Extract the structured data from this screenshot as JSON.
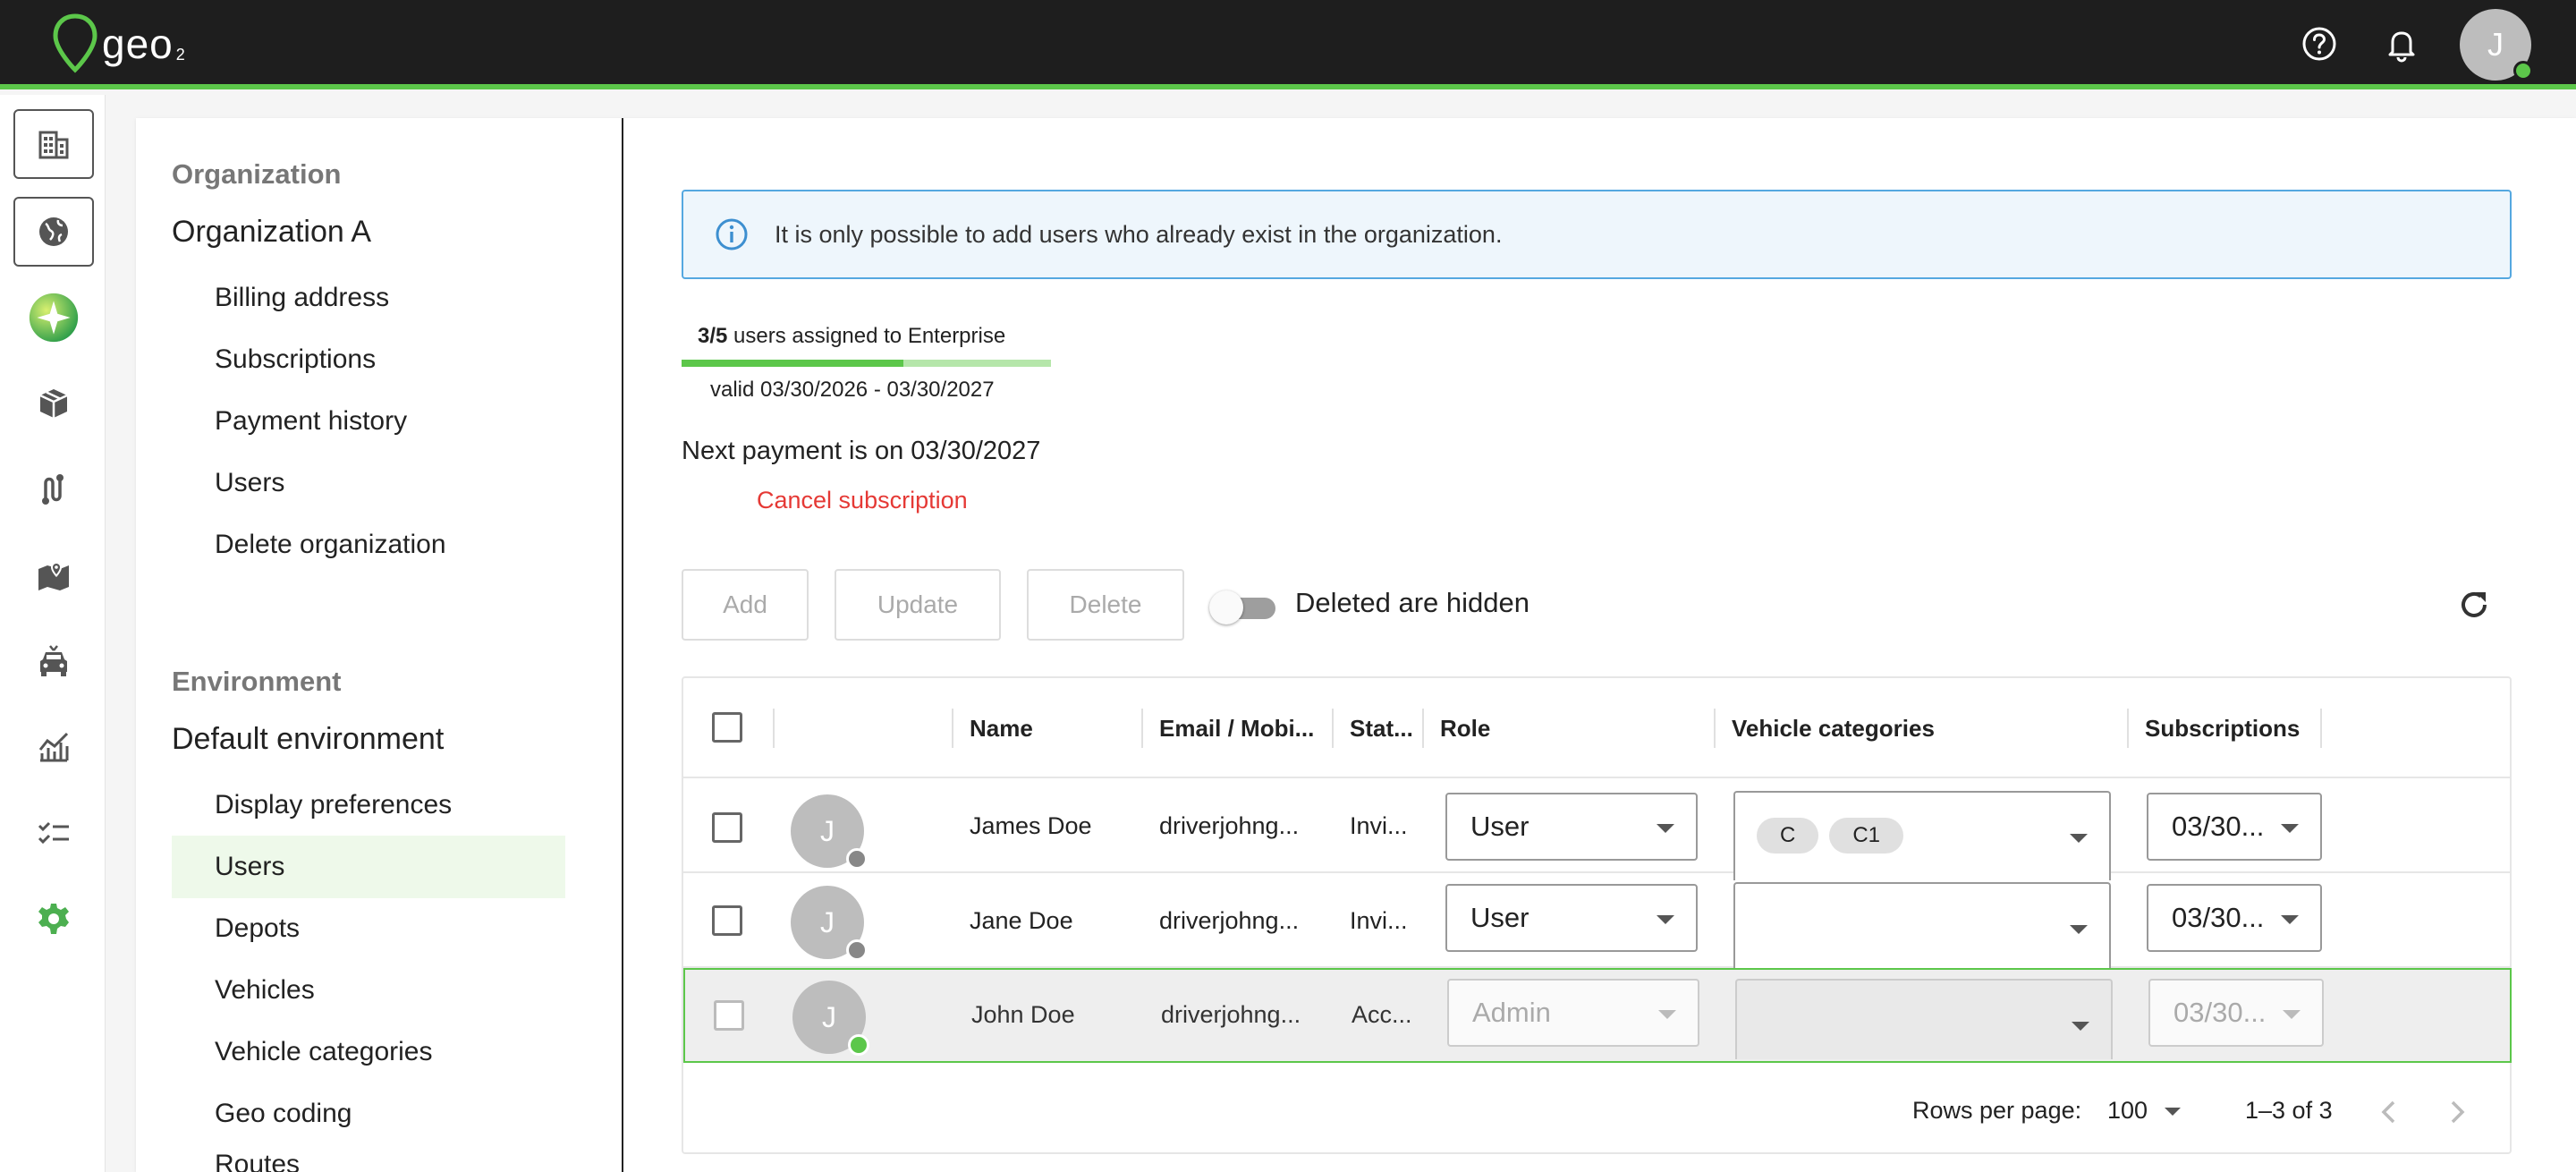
{
  "brand": {
    "name": "geo",
    "sub": "2"
  },
  "topbar": {
    "avatar_initial": "J"
  },
  "rail": {
    "icons": [
      "building-icon",
      "globe-icon",
      "ai-sparkle-icon",
      "package-icon",
      "route-icon",
      "map-pin-icon",
      "vehicle-icon",
      "analytics-icon",
      "checklist-icon",
      "settings-icon"
    ]
  },
  "nav": {
    "org_section": "Organization",
    "org_name": "Organization A",
    "org_items": [
      "Billing address",
      "Subscriptions",
      "Payment history",
      "Users",
      "Delete organization"
    ],
    "env_section": "Environment",
    "env_name": "Default environment",
    "env_items": [
      "Display preferences",
      "Users",
      "Depots",
      "Vehicles",
      "Vehicle categories",
      "Geo coding",
      "Routes"
    ],
    "active_item": "Users"
  },
  "info": {
    "text": "It is only possible to add users who already exist in the organization."
  },
  "seats": {
    "count": "3/5",
    "text": " users assigned to Enterprise",
    "assigned": 3,
    "total": 5,
    "valid": "valid 03/30/2026 - 03/30/2027"
  },
  "payment": {
    "next": "Next payment is on 03/30/2027",
    "cancel_label": "Cancel subscription"
  },
  "toolbar": {
    "add": "Add",
    "update": "Update",
    "delete": "Delete",
    "toggle_label": "Deleted are hidden"
  },
  "table": {
    "columns": {
      "name": "Name",
      "email": "Email / Mobi...",
      "status": "Stat...",
      "role": "Role",
      "vehicle_categories": "Vehicle categories",
      "subscriptions": "Subscriptions"
    },
    "rows": [
      {
        "initial": "J",
        "name": "James Doe",
        "email": "driverjohng...",
        "status": "Invi...",
        "role": "User",
        "chips": [
          "C",
          "C1"
        ],
        "subscription": "03/30..."
      },
      {
        "initial": "J",
        "name": "Jane Doe",
        "email": "driverjohng...",
        "status": "Invi...",
        "role": "User",
        "chips": [],
        "subscription": "03/30..."
      },
      {
        "initial": "J",
        "name": "John Doe",
        "email": "driverjohng...",
        "status": "Acc...",
        "role": "Admin",
        "chips": [],
        "subscription": "03/30..."
      }
    ],
    "footer": {
      "rows_per_page_label": "Rows per page:",
      "rows_per_page": "100",
      "range": "1–3 of 3"
    }
  },
  "colors": {
    "accent": "#5cc74a",
    "topbar": "#1e1e1e",
    "danger": "#e53935",
    "info_border": "#55a8e0"
  }
}
